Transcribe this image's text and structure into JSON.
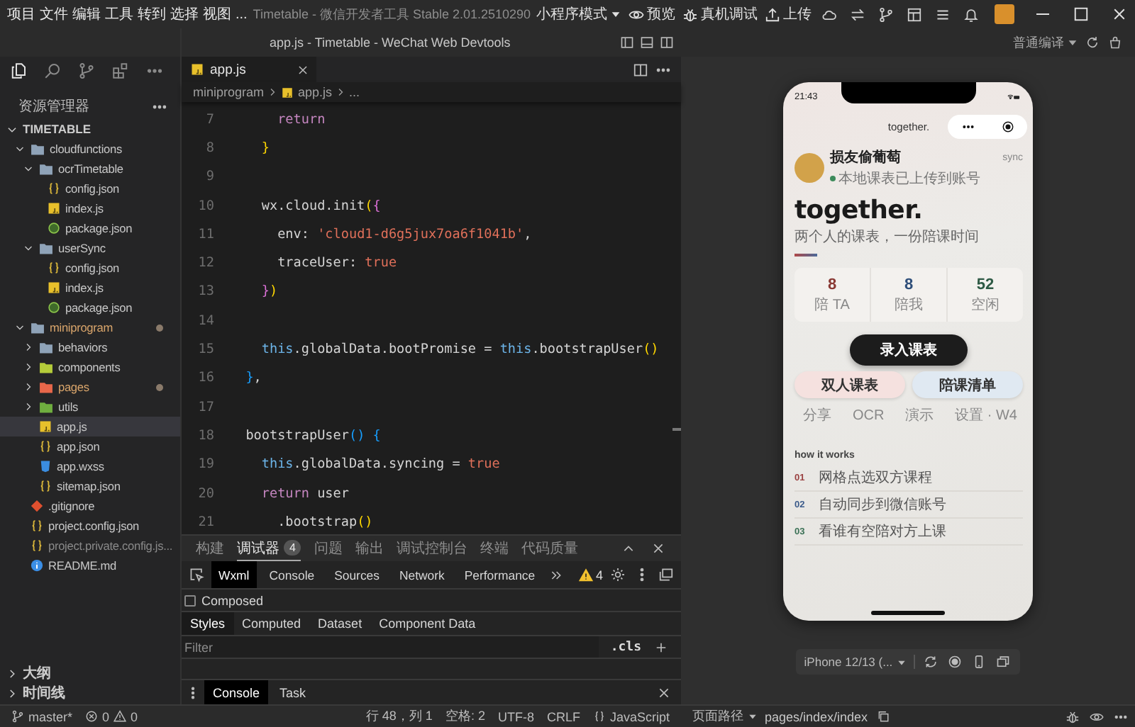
{
  "menu_bar": {
    "items": [
      "项目",
      "文件",
      "编辑",
      "工具",
      "转到",
      "选择",
      "视图",
      "..."
    ],
    "title": "Timetable - 微信开发者工具 Stable 2.01.2510290",
    "mode": "小程序模式",
    "actions": [
      {
        "kind": "preview",
        "label": "预览"
      },
      {
        "kind": "remote-debug",
        "label": "真机调试"
      },
      {
        "kind": "upload",
        "label": "上传"
      }
    ]
  },
  "window_title": "app.js - Timetable - WeChat Web Devtools",
  "compile_mode": "普通编译",
  "explorer": {
    "title": "资源管理器",
    "root": "TIMETABLE",
    "root_expanded": true,
    "tree": [
      {
        "label": "cloudfunctions",
        "kind": "folder",
        "color": "#8fa3b8",
        "expanded": true,
        "selected": false,
        "modified": false,
        "ignored": false,
        "children": [
          {
            "label": "ocrTimetable",
            "kind": "folder",
            "color": "#8fa3b8",
            "expanded": true,
            "selected": false,
            "modified": false,
            "ignored": false,
            "children": [
              {
                "label": "config.json",
                "kind": "json",
                "selected": false,
                "modified": false,
                "ignored": false
              },
              {
                "label": "index.js",
                "kind": "js",
                "selected": false,
                "modified": false,
                "ignored": false
              },
              {
                "label": "package.json",
                "kind": "package",
                "selected": false,
                "modified": false,
                "ignored": false
              }
            ]
          },
          {
            "label": "userSync",
            "kind": "folder",
            "color": "#8fa3b8",
            "expanded": true,
            "selected": false,
            "modified": false,
            "ignored": false,
            "children": [
              {
                "label": "config.json",
                "kind": "json",
                "selected": false,
                "modified": false,
                "ignored": false
              },
              {
                "label": "index.js",
                "kind": "js",
                "selected": false,
                "modified": false,
                "ignored": false
              },
              {
                "label": "package.json",
                "kind": "package",
                "selected": false,
                "modified": false,
                "ignored": false
              }
            ]
          }
        ]
      },
      {
        "label": "miniprogram",
        "kind": "folder",
        "color": "#8fa3b8",
        "expanded": true,
        "selected": false,
        "modified": true,
        "ignored": false,
        "children": [
          {
            "label": "behaviors",
            "kind": "folder",
            "color": "#8fa3b8",
            "expanded": false,
            "selected": false,
            "modified": false,
            "ignored": false
          },
          {
            "label": "components",
            "kind": "folder",
            "color": "#b5cc3a",
            "expanded": false,
            "selected": false,
            "modified": false,
            "ignored": false
          },
          {
            "label": "pages",
            "kind": "folder",
            "color": "#e8674a",
            "expanded": false,
            "selected": false,
            "modified": true,
            "ignored": false
          },
          {
            "label": "utils",
            "kind": "folder",
            "color": "#6fae3f",
            "expanded": false,
            "selected": false,
            "modified": false,
            "ignored": false
          },
          {
            "label": "app.js",
            "kind": "js",
            "selected": true,
            "modified": false,
            "ignored": false
          },
          {
            "label": "app.json",
            "kind": "json",
            "selected": false,
            "modified": false,
            "ignored": false
          },
          {
            "label": "app.wxss",
            "kind": "wxss",
            "selected": false,
            "modified": false,
            "ignored": false
          },
          {
            "label": "sitemap.json",
            "kind": "json",
            "selected": false,
            "modified": false,
            "ignored": false
          }
        ]
      },
      {
        "label": ".gitignore",
        "kind": "git",
        "selected": false,
        "modified": false,
        "ignored": false
      },
      {
        "label": "project.config.json",
        "kind": "json",
        "selected": false,
        "modified": false,
        "ignored": false
      },
      {
        "label": "project.private.config.js...",
        "kind": "json",
        "selected": false,
        "modified": false,
        "ignored": true
      },
      {
        "label": "README.md",
        "kind": "info",
        "selected": false,
        "modified": false,
        "ignored": false
      }
    ]
  },
  "side_panels": [
    {
      "label": "大纲",
      "expanded": false
    },
    {
      "label": "时间线",
      "expanded": false
    }
  ],
  "editor": {
    "tab": "app.js",
    "breadcrumb": [
      {
        "kind": "folder",
        "label": "miniprogram"
      },
      {
        "kind": "file",
        "label": "app.js"
      },
      {
        "kind": "more",
        "label": "..."
      }
    ],
    "lines": [
      {
        "number": "7",
        "tokens": [
          {
            "text": "      return",
            "kind": "keyword"
          }
        ]
      },
      {
        "number": "8",
        "tokens": [
          {
            "text": "    }",
            "kind": "bracket1"
          }
        ]
      },
      {
        "number": "9"
      },
      {
        "number": "10",
        "tokens": [
          {
            "text": "    wx.cloud.init",
            "kind": "plain"
          },
          {
            "text": "(",
            "kind": "bracket1"
          },
          {
            "text": "{",
            "kind": "bracket2"
          }
        ]
      },
      {
        "number": "11",
        "tokens": [
          {
            "text": "      env: ",
            "kind": "plain"
          },
          {
            "text": "'cloud1-d6g5jux7oa6f1041b'",
            "kind": "string"
          },
          {
            "text": ",",
            "kind": "plain"
          }
        ]
      },
      {
        "number": "12",
        "tokens": [
          {
            "text": "      traceUser: ",
            "kind": "plain"
          },
          {
            "text": "true",
            "kind": "boolean"
          }
        ]
      },
      {
        "number": "13",
        "tokens": [
          {
            "text": "    }",
            "kind": "bracket2"
          },
          {
            "text": ")",
            "kind": "bracket1"
          }
        ]
      },
      {
        "number": "14"
      },
      {
        "number": "15",
        "tokens": [
          {
            "text": "    this",
            "kind": "this"
          },
          {
            "text": ".globalData.bootPromise = ",
            "kind": "plain"
          },
          {
            "text": "this",
            "kind": "this"
          },
          {
            "text": ".bootstrapUser",
            "kind": "plain"
          },
          {
            "text": "()",
            "kind": "bracket1"
          }
        ]
      },
      {
        "number": "16",
        "tokens": [
          {
            "text": "  }",
            "kind": "bracket3"
          },
          {
            "text": ",",
            "kind": "plain"
          }
        ]
      },
      {
        "number": "17"
      },
      {
        "number": "18",
        "tokens": [
          {
            "text": "  bootstrapUser",
            "kind": "plain"
          },
          {
            "text": "()",
            "kind": "bracket3"
          },
          {
            "text": " {",
            "kind": "bracket3"
          }
        ]
      },
      {
        "number": "19",
        "tokens": [
          {
            "text": "    this",
            "kind": "this"
          },
          {
            "text": ".globalData.syncing = ",
            "kind": "plain"
          },
          {
            "text": "true",
            "kind": "boolean"
          }
        ]
      },
      {
        "number": "20",
        "tokens": [
          {
            "text": "    return",
            "kind": "keyword"
          },
          {
            "text": " user",
            "kind": "plain"
          }
        ]
      },
      {
        "number": "21",
        "tokens": [
          {
            "text": "      .bootstrap",
            "kind": "plain"
          },
          {
            "text": "()",
            "kind": "bracket1"
          }
        ]
      }
    ]
  },
  "devtools": {
    "panel_tabs": [
      {
        "label": "构建",
        "selected": false
      },
      {
        "label": "调试器",
        "selected": true,
        "badge": "4"
      },
      {
        "label": "问题",
        "selected": false
      },
      {
        "label": "输出",
        "selected": false
      },
      {
        "label": "调试控制台",
        "selected": false
      },
      {
        "label": "终端",
        "selected": false
      },
      {
        "label": "代码质量",
        "selected": false
      }
    ],
    "tool_tabs": [
      {
        "label": "Wxml",
        "selected": true
      },
      {
        "label": "Console",
        "selected": false
      },
      {
        "label": "Sources",
        "selected": false
      },
      {
        "label": "Network",
        "selected": false
      },
      {
        "label": "Performance",
        "selected": false
      }
    ],
    "warnings": "4",
    "composed": {
      "label": "Composed",
      "checked": false
    },
    "style_tabs": [
      {
        "label": "Styles",
        "selected": true
      },
      {
        "label": "Computed",
        "selected": false
      },
      {
        "label": "Dataset",
        "selected": false
      },
      {
        "label": "Component Data",
        "selected": false
      }
    ],
    "filter": {
      "placeholder": "Filter"
    },
    "cls": ".cls",
    "drawer_tabs": [
      {
        "label": "Console",
        "selected": true
      },
      {
        "label": "Task",
        "selected": false
      }
    ]
  },
  "status_bar": {
    "branch": "master*",
    "errors": "0",
    "warnings": "0",
    "items": [
      "行 48，列 1",
      "空格: 2",
      "UTF-8",
      "CRLF"
    ],
    "language": "JavaScript",
    "page_path_label": "页面路径",
    "page_path": "pages/index/index"
  },
  "simulator": {
    "device": "iPhone 12/13 (...",
    "phone": {
      "time": "21:43",
      "nav_title": "together.",
      "user": {
        "name": "损友偷葡萄",
        "status": "本地课表已上传到账号",
        "action": "sync"
      },
      "headline": "together.",
      "tagline": "两个人的课表，一份陪课时间",
      "stats": [
        {
          "value": "8",
          "label": "陪 TA",
          "color": "#8a3a35"
        },
        {
          "value": "8",
          "label": "陪我",
          "color": "#2f4f7a"
        },
        {
          "value": "52",
          "label": "空闲",
          "color": "#2e5a45"
        }
      ],
      "primary_button": "录入课表",
      "buttons": [
        {
          "label": "双人课表",
          "color": "#f5e1df"
        },
        {
          "label": "陪课清单",
          "color": "#e0e9f2"
        }
      ],
      "links": [
        "分享",
        "OCR",
        "演示",
        "设置 · W4"
      ],
      "section_title": "how it works",
      "steps": [
        {
          "number": "01",
          "text": "网格点选双方课程",
          "color": "#9a4040"
        },
        {
          "number": "02",
          "text": "自动同步到微信账号",
          "color": "#3a5a8a"
        },
        {
          "number": "03",
          "text": "看谁有空陪对方上课",
          "color": "#3a7055"
        }
      ]
    }
  }
}
